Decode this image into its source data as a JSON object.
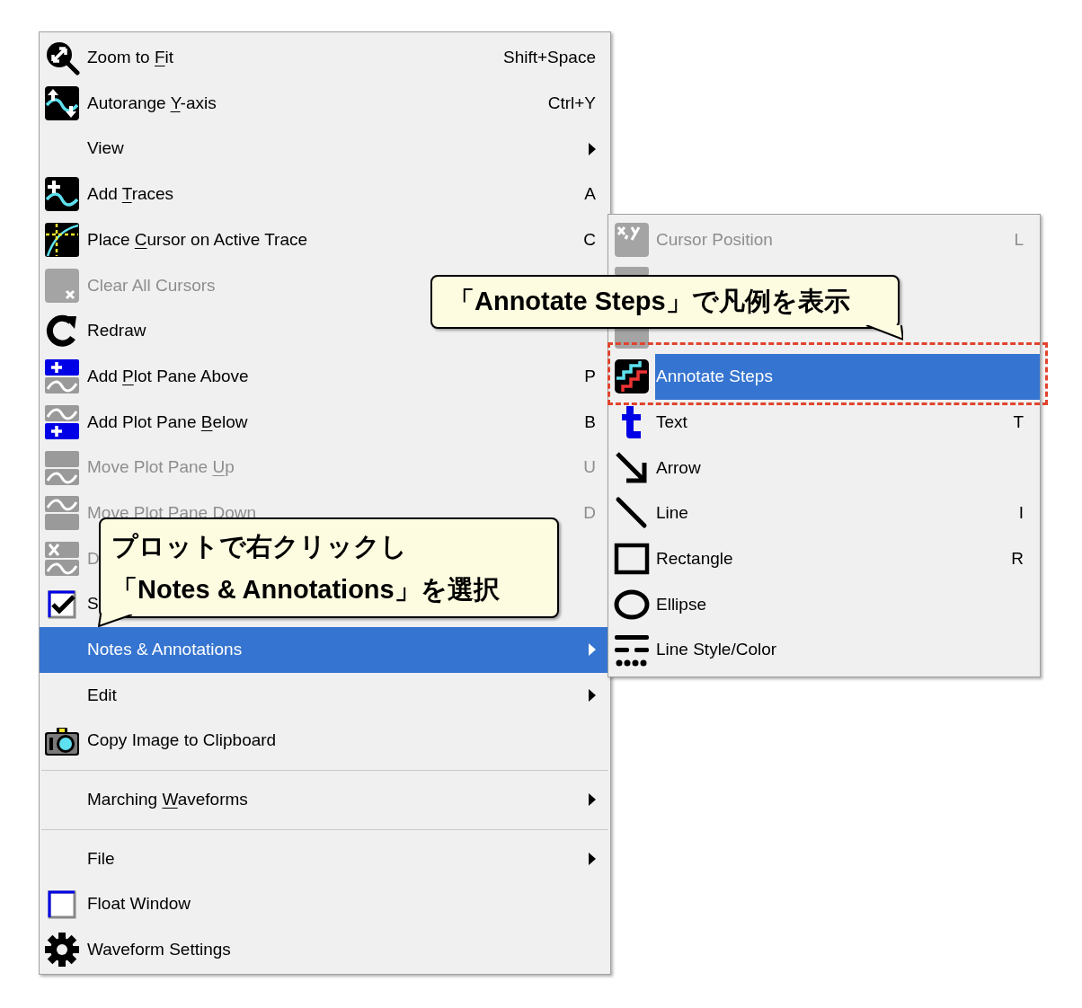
{
  "context_menu": {
    "items": [
      {
        "kind": "item",
        "label_parts": [
          "Zoom to ",
          "F",
          "it"
        ],
        "shortcut": "Shift+Space",
        "submenu": false,
        "disabled": false,
        "selected": false
      },
      {
        "kind": "item",
        "label_parts": [
          "Autorange ",
          "Y",
          "-axis"
        ],
        "shortcut": "Ctrl+Y",
        "submenu": false,
        "disabled": false,
        "selected": false
      },
      {
        "kind": "item",
        "label_parts": [
          "View"
        ],
        "submenu": true,
        "disabled": false,
        "selected": false
      },
      {
        "kind": "item",
        "label_parts": [
          "Add ",
          "T",
          "races"
        ],
        "shortcut": "A",
        "submenu": false,
        "disabled": false,
        "selected": false
      },
      {
        "kind": "item",
        "label_parts": [
          "Place ",
          "C",
          "ursor on Active Trace"
        ],
        "shortcut": "C",
        "submenu": false,
        "disabled": false,
        "selected": false
      },
      {
        "kind": "item",
        "label_parts": [
          "Clear All Cursors"
        ],
        "submenu": false,
        "disabled": true,
        "selected": false
      },
      {
        "kind": "item",
        "label_parts": [
          "Redraw"
        ],
        "submenu": false,
        "disabled": false,
        "selected": false
      },
      {
        "kind": "item",
        "label_parts": [
          "Add ",
          "P",
          "lot Pane Above"
        ],
        "shortcut": "P",
        "submenu": false,
        "disabled": false,
        "selected": false
      },
      {
        "kind": "item",
        "label_parts": [
          "Add Plot Pane ",
          "B",
          "elow"
        ],
        "shortcut": "B",
        "submenu": false,
        "disabled": false,
        "selected": false
      },
      {
        "kind": "item",
        "label_parts": [
          "Move Plot Pane ",
          "U",
          "p"
        ],
        "shortcut": "U",
        "submenu": false,
        "disabled": true,
        "selected": false
      },
      {
        "kind": "item",
        "label_parts": [
          "Move Plot Pane Down"
        ],
        "shortcut": "D",
        "submenu": false,
        "disabled": true,
        "selected": false
      },
      {
        "kind": "item",
        "label_parts": [
          "D"
        ],
        "submenu": false,
        "disabled": true,
        "selected": false
      },
      {
        "kind": "check",
        "label_parts": [
          "S"
        ],
        "checked": true,
        "submenu": false,
        "disabled": false,
        "selected": false
      },
      {
        "kind": "item",
        "label_parts": [
          "Notes & Annotations"
        ],
        "submenu": true,
        "disabled": false,
        "selected": true
      },
      {
        "kind": "item",
        "label_parts": [
          "Edit"
        ],
        "submenu": true,
        "disabled": false,
        "selected": false
      },
      {
        "kind": "item",
        "label_parts": [
          "Copy Image to Clipboard"
        ],
        "submenu": false,
        "disabled": false,
        "selected": false
      },
      {
        "kind": "separator"
      },
      {
        "kind": "item",
        "label_parts": [
          "Marching ",
          "W",
          "aveforms"
        ],
        "submenu": true,
        "disabled": false,
        "selected": false
      },
      {
        "kind": "separator"
      },
      {
        "kind": "item",
        "label_parts": [
          "File"
        ],
        "submenu": true,
        "disabled": false,
        "selected": false
      },
      {
        "kind": "check",
        "label_parts": [
          "Float Window"
        ],
        "checked": false,
        "submenu": false,
        "disabled": false,
        "selected": false
      },
      {
        "kind": "item",
        "label_parts": [
          "Waveform Settings"
        ],
        "submenu": false,
        "disabled": false,
        "selected": false
      }
    ]
  },
  "submenu": {
    "items": [
      {
        "label": "Cursor Position",
        "shortcut": "L",
        "disabled": true,
        "selected": false
      },
      {
        "disabled": true,
        "selected": false
      },
      {
        "disabled": true,
        "selected": false
      },
      {
        "label": "Annotate Steps",
        "disabled": false,
        "selected": true
      },
      {
        "label": "Text",
        "shortcut": "T",
        "disabled": false,
        "selected": false
      },
      {
        "label": "Arrow",
        "disabled": false,
        "selected": false
      },
      {
        "label": "Line",
        "shortcut": "I",
        "disabled": false,
        "selected": false
      },
      {
        "label": "Rectangle",
        "shortcut": "R",
        "disabled": false,
        "selected": false
      },
      {
        "label": "Ellipse",
        "disabled": false,
        "selected": false
      },
      {
        "label": "Line Style/Color",
        "disabled": false,
        "selected": false
      }
    ]
  },
  "callouts": [
    {
      "lines": [
        "「Annotate Steps」で凡例を表示"
      ]
    },
    {
      "lines": [
        "プロットで右クリックし",
        "「Notes & Annotations」を選択"
      ]
    }
  ]
}
